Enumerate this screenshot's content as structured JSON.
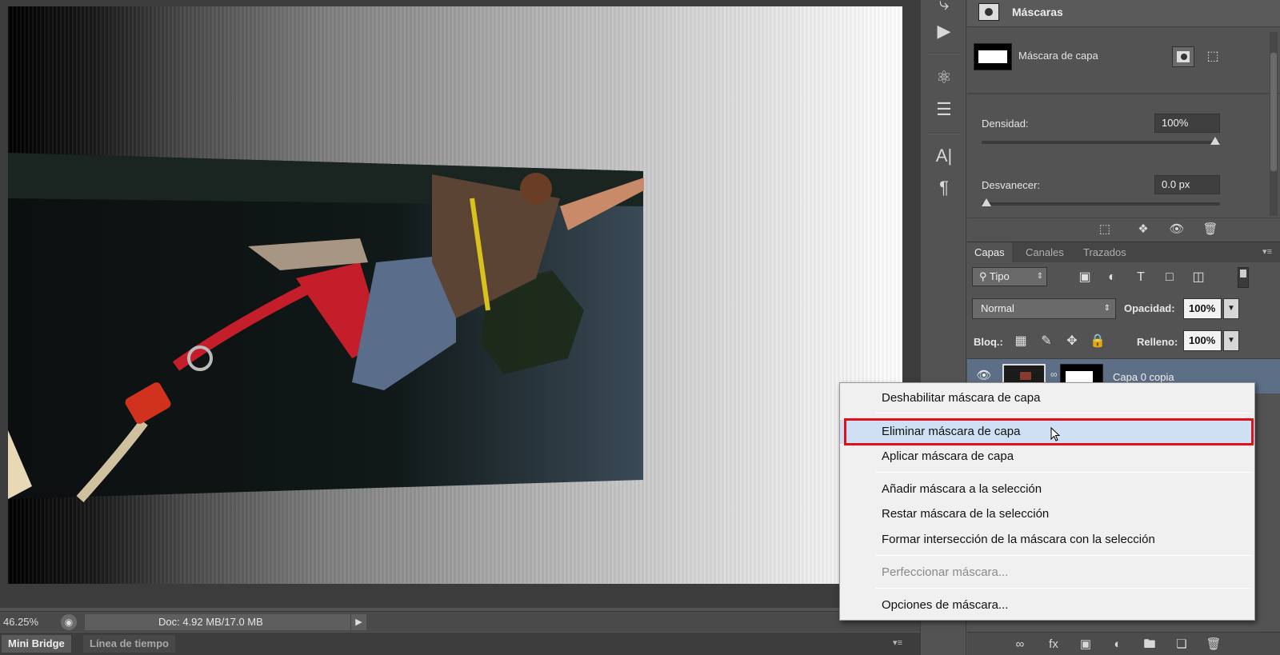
{
  "status": {
    "zoom": "46.25%",
    "doc_info": "Doc: 4.92 MB/17.0 MB"
  },
  "bottom_tabs": [
    "Mini Bridge",
    "Línea de tiempo"
  ],
  "masks_panel": {
    "title": "Máscaras",
    "layer_mask_label": "Máscara de capa",
    "density_label": "Densidad:",
    "density_value": "100%",
    "density_level": 1.0,
    "feather_label": "Desvanecer:",
    "feather_value": "0.0 px",
    "feather_level": 0.0
  },
  "layers_panel": {
    "tabs": [
      "Capas",
      "Canales",
      "Trazados"
    ],
    "filter_label": "Tipo",
    "blend_mode": "Normal",
    "opacity_label": "Opacidad:",
    "opacity_value": "100%",
    "lock_label": "Bloq.:",
    "fill_label": "Relleno:",
    "fill_value": "100%",
    "layer_name": "Capa 0 copia"
  },
  "context_menu": {
    "items": [
      {
        "label": "Deshabilitar máscara de capa",
        "disabled": false
      },
      {
        "label": "Eliminar máscara de capa",
        "disabled": false
      },
      {
        "label": "Aplicar máscara de capa",
        "disabled": false
      },
      {
        "label": "Añadir máscara a la selección",
        "disabled": false
      },
      {
        "label": "Restar máscara de la selección",
        "disabled": false
      },
      {
        "label": "Formar intersección de la máscara con la selección",
        "disabled": false
      },
      {
        "label": "Perfeccionar máscara...",
        "disabled": true
      },
      {
        "label": "Opciones de máscara...",
        "disabled": false
      }
    ],
    "highlighted_item": "Eliminar máscara de capa",
    "highlight_color": "#e3101c"
  },
  "icons": {
    "tools": [
      "history-brush-icon",
      "play-action-icon",
      "tool-presets-icon",
      "adjust-sliders-icon",
      "character-icon",
      "paragraph-icon"
    ],
    "mask_panel": [
      "mask-icon",
      "pixel-mask-icon",
      "vector-mask-icon",
      "selection-icon",
      "apply-mask-icon",
      "visibility-icon",
      "delete-icon"
    ],
    "layers_filter": [
      "search-icon",
      "image-filter-icon",
      "adjustment-filter-icon",
      "text-filter-icon",
      "shape-filter-icon",
      "smart-object-filter-icon"
    ],
    "locks": [
      "lock-transparent-icon",
      "lock-image-icon",
      "lock-position-icon",
      "lock-all-icon"
    ],
    "layers_bottom": [
      "link-icon",
      "fx-icon",
      "add-mask-icon",
      "adjustment-layer-icon",
      "new-group-icon",
      "new-layer-icon",
      "trash-icon"
    ]
  }
}
